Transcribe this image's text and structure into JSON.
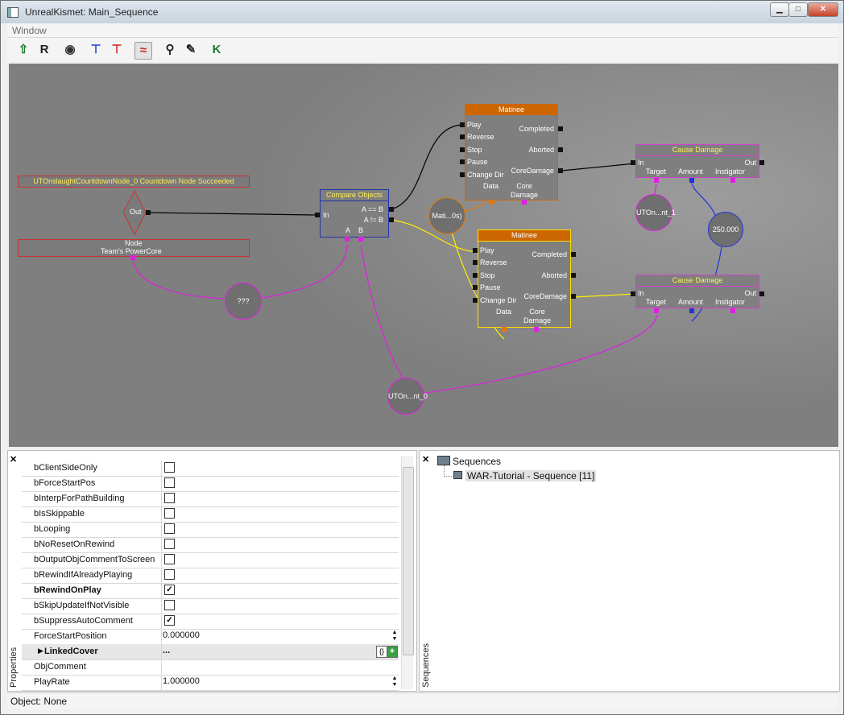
{
  "window": {
    "title": "UnrealKismet: Main_Sequence",
    "minimize": "▁",
    "maximize": "□",
    "close": "✕"
  },
  "menu": {
    "window": "Window"
  },
  "toolbar": [
    {
      "icon": "up-arrow-icon",
      "glyph": "⇧",
      "color": "#1a7a2a"
    },
    {
      "icon": "refresh-icon",
      "glyph": "R",
      "color": "#222222"
    },
    {
      "icon": "eye-icon",
      "glyph": "◉",
      "color": "#333333"
    },
    {
      "icon": "connect-down-icon",
      "glyph": "⊤",
      "color": "#2244cc"
    },
    {
      "icon": "connect-up-icon",
      "glyph": "⊤",
      "color": "#cc2222"
    },
    {
      "icon": "curve-icon",
      "glyph": "≈",
      "color": "#cc2222"
    },
    {
      "icon": "search-icon",
      "glyph": "⚲",
      "color": "#222222"
    },
    {
      "icon": "wrench-icon",
      "glyph": "✎",
      "color": "#222222"
    },
    {
      "icon": "kismet-icon",
      "glyph": "K",
      "color": "#1a7a2a"
    }
  ],
  "graph": {
    "event": {
      "title": "UTOnslaughtCountdownNode_0 Countdown Node Succeeded",
      "out": "Out",
      "node_label": "Node",
      "node_value": "Team's PowerCore"
    },
    "compare": {
      "title": "Compare Objects",
      "in": "In",
      "eq": "A == B",
      "neq": "A != B",
      "a": "A",
      "b": "B"
    },
    "matinee1": {
      "title": "Matinee",
      "inputs": [
        "Play",
        "Reverse",
        "Stop",
        "Pause",
        "Change Dir"
      ],
      "outputs": [
        "Completed",
        "Aborted",
        "CoreDamage"
      ],
      "vars": [
        "Data",
        "Core\nDamage"
      ]
    },
    "matinee2": {
      "title": "Matinee",
      "inputs": [
        "Play",
        "Reverse",
        "Stop",
        "Pause",
        "Change Dir"
      ],
      "outputs": [
        "Completed",
        "Aborted",
        "CoreDamage"
      ],
      "vars": [
        "Data",
        "Core\nDamage"
      ]
    },
    "damage1": {
      "title": "Cause Damage",
      "in": "In",
      "out": "Out",
      "vars": [
        "Target",
        "Amount",
        "Instigator"
      ]
    },
    "damage2": {
      "title": "Cause Damage",
      "in": "In",
      "out": "Out",
      "vars": [
        "Target",
        "Amount",
        "Instigator"
      ]
    },
    "var_matinee": "Mati...0s)",
    "var_unknown": "???",
    "var_target1": "UTOn...nt_1",
    "var_amount": "250.000",
    "var_target0": "UTOn...nt_0"
  },
  "properties": {
    "tab": "Properties",
    "rows": [
      {
        "name": "bClientSideOnly",
        "type": "check",
        "checked": false
      },
      {
        "name": "bForceStartPos",
        "type": "check",
        "checked": false
      },
      {
        "name": "bInterpForPathBuilding",
        "type": "check",
        "checked": false
      },
      {
        "name": "bIsSkippable",
        "type": "check",
        "checked": false
      },
      {
        "name": "bLooping",
        "type": "check",
        "checked": false
      },
      {
        "name": "bNoResetOnRewind",
        "type": "check",
        "checked": false
      },
      {
        "name": "bOutputObjCommentToScreen",
        "type": "check",
        "checked": false
      },
      {
        "name": "bRewindIfAlreadyPlaying",
        "type": "check",
        "checked": false
      },
      {
        "name": "bRewindOnPlay",
        "type": "check",
        "checked": true,
        "bold": true
      },
      {
        "name": "bSkipUpdateIfNotVisible",
        "type": "check",
        "checked": false
      },
      {
        "name": "bSuppressAutoComment",
        "type": "check",
        "checked": true
      },
      {
        "name": "ForceStartPosition",
        "type": "number",
        "value": "0.000000"
      },
      {
        "name": "LinkedCover",
        "type": "array",
        "value": "...",
        "bold": true,
        "expandable": true
      },
      {
        "name": "ObjComment",
        "type": "text",
        "value": ""
      },
      {
        "name": "PlayRate",
        "type": "number",
        "value": "1.000000"
      }
    ]
  },
  "sequences": {
    "tab": "Sequences",
    "root": "Sequences",
    "items": [
      "WAR-Tutorial - Sequence [11]"
    ]
  },
  "status": {
    "text": "Object: None"
  },
  "colors": {
    "canvas": "#7f7f7f",
    "event_border": "#cc3333",
    "compare_border": "#2233aa",
    "matinee_head": "#cc6600",
    "matinee2_border": "#ffdd00",
    "damage_border": "#d040d0",
    "var_link": "#e020e0"
  }
}
